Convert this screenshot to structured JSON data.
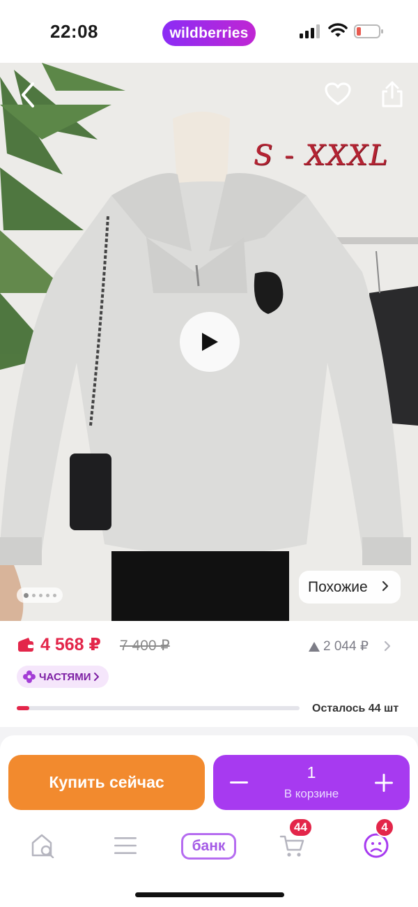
{
  "status_bar": {
    "time": "22:08",
    "app_badge": "wildberries",
    "battery_color": "#e85a4f"
  },
  "product_media": {
    "overlay_text": "S - XXXL",
    "gallery_dots": 5,
    "active_dot": 1,
    "similar_button_label": "Похожие",
    "icons": [
      "back-arrow",
      "heart",
      "share",
      "play",
      "chevron-right"
    ]
  },
  "price_block": {
    "current_price": "4 568 ₽",
    "old_price": "7 400 ₽",
    "price_change": "2 044 ₽",
    "installments_label": "ЧАСТЯМИ",
    "stock_label": "Осталось 44 шт",
    "stock_progress_fraction": 0.045,
    "price_color": "#e3264a"
  },
  "actions": {
    "buy_now_label": "Купить сейчас",
    "cart_quantity": "1",
    "in_cart_label": "В корзине",
    "buy_color": "#f28a2e",
    "cart_color": "#a73af0"
  },
  "bottom_nav": {
    "bank_label": "банк",
    "cart_badge": "44",
    "profile_badge": "4",
    "items": [
      "home-search",
      "catalog",
      "bank",
      "cart",
      "profile"
    ]
  }
}
